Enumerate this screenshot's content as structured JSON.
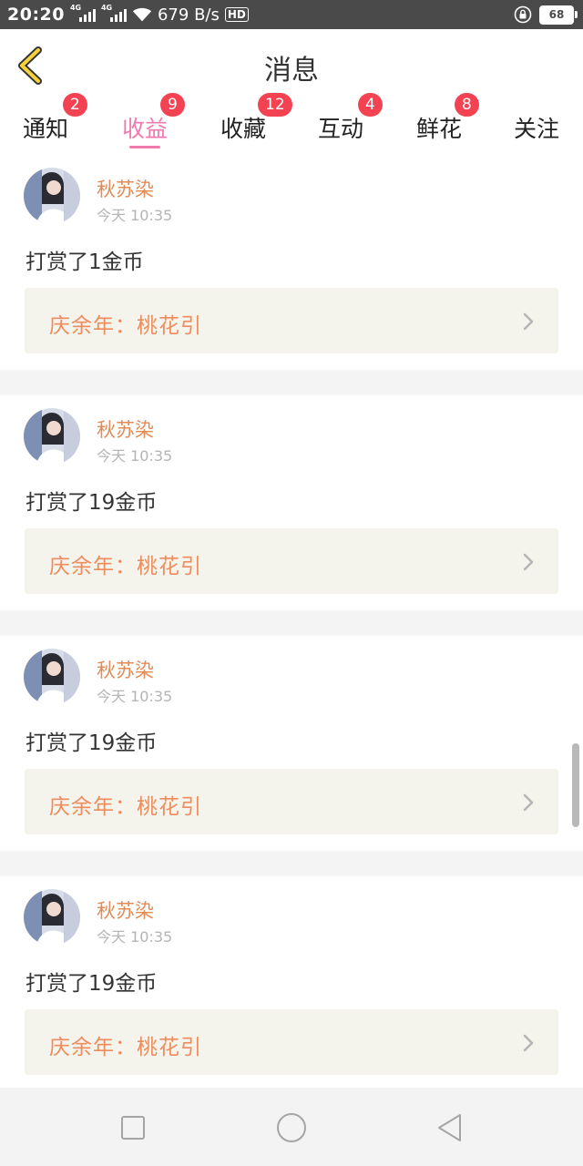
{
  "status_bar": {
    "time": "20:20",
    "net_speed": "679 B/s",
    "network_1": "4G",
    "network_2": "4G",
    "hd_label": "HD",
    "battery": "68"
  },
  "header": {
    "title": "消息",
    "back_icon": "chevron-left-icon"
  },
  "tabs": [
    {
      "label": "通知",
      "badge": "2"
    },
    {
      "label": "收益",
      "badge": "9",
      "active": true
    },
    {
      "label": "收藏",
      "badge": "12"
    },
    {
      "label": "互动",
      "badge": "4"
    },
    {
      "label": "鲜花",
      "badge": "8"
    },
    {
      "label": "关注"
    }
  ],
  "colors": {
    "accent": "#f07ab0",
    "badge": "#f34352",
    "username": "#e28b57",
    "work_title": "#ef8c5b",
    "work_card_bg": "#f4f3ec"
  },
  "messages": [
    {
      "user": "秋苏染",
      "time": "今天 10:35",
      "text": "打赏了1金币",
      "work": "庆余年：桃花引"
    },
    {
      "user": "秋苏染",
      "time": "今天 10:35",
      "text": "打赏了19金币",
      "work": "庆余年：桃花引"
    },
    {
      "user": "秋苏染",
      "time": "今天 10:35",
      "text": "打赏了19金币",
      "work": "庆余年：桃花引"
    },
    {
      "user": "秋苏染",
      "time": "今天 10:35",
      "text": "打赏了19金币",
      "work": "庆余年：桃花引"
    }
  ],
  "nav_bar": {
    "recent_icon": "square-icon",
    "home_icon": "circle-icon",
    "back_icon": "triangle-back-icon"
  }
}
